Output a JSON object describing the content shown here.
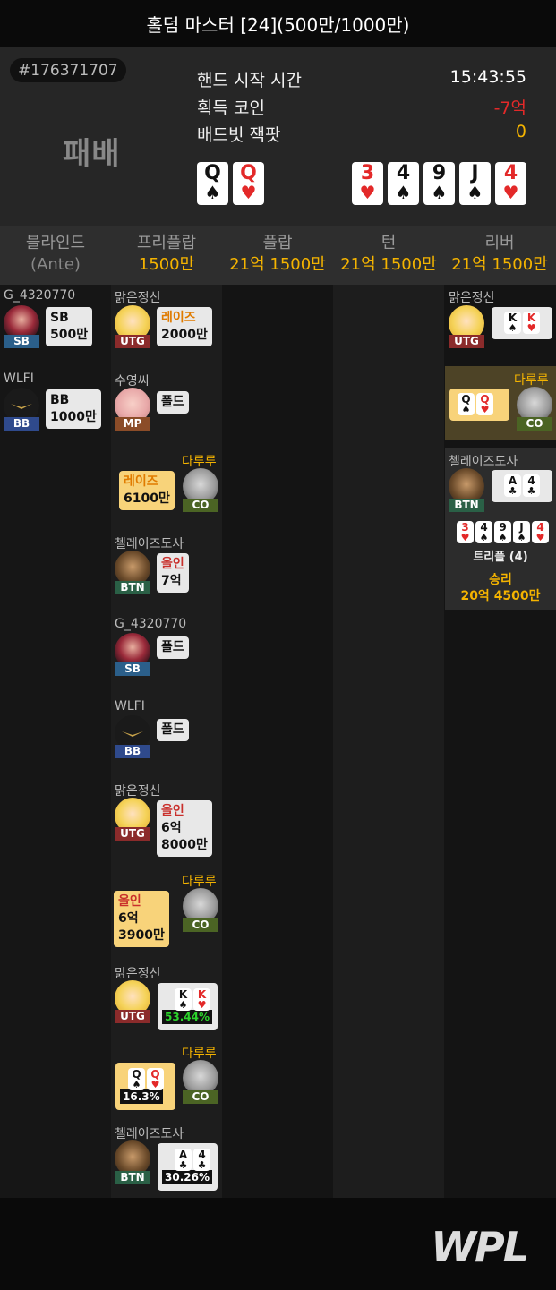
{
  "title": "홀덤 마스터 [24](500만/1000만)",
  "hand_id": "#176371707",
  "result": "패배",
  "info": [
    {
      "label": "핸드 시작 시간",
      "value": "15:43:55",
      "color": "#ffffff"
    },
    {
      "label": "획득 코인",
      "value": "-7억",
      "color": "#e32929"
    },
    {
      "label": "배드빗 잭팟",
      "value": "0",
      "color": "#f5b400"
    }
  ],
  "hole_cards": [
    {
      "rank": "Q",
      "suit": "♠"
    },
    {
      "rank": "Q",
      "suit": "♥"
    }
  ],
  "board_cards": [
    {
      "rank": "3",
      "suit": "♥"
    },
    {
      "rank": "4",
      "suit": "♠"
    },
    {
      "rank": "9",
      "suit": "♠"
    },
    {
      "rank": "J",
      "suit": "♠"
    },
    {
      "rank": "4",
      "suit": "♥"
    }
  ],
  "streets": [
    {
      "name": "블라인드",
      "amount": "(Ante)"
    },
    {
      "name": "프리플랍",
      "amount": "1500만"
    },
    {
      "name": "플랍",
      "amount": "21억 1500만"
    },
    {
      "name": "턴",
      "amount": "21억 1500만"
    },
    {
      "name": "리버",
      "amount": "21억 1500만"
    }
  ],
  "blinds": [
    {
      "name": "G_4320770",
      "position": "SB",
      "line1": "SB",
      "line2": "500만"
    },
    {
      "name": "WLFI",
      "position": "BB",
      "line1": "BB",
      "line2": "1000만"
    }
  ],
  "preflop": [
    {
      "name": "맑은정신",
      "position": "UTG",
      "action": "레이즈",
      "amount": "2000만"
    },
    {
      "name": "수영씨",
      "position": "MP",
      "action": "폴드"
    },
    {
      "name": "다루루",
      "position": "CO",
      "action": "레이즈",
      "amount": "6100만"
    },
    {
      "name": "첼레이즈도사",
      "position": "BTN",
      "action": "올인",
      "amount": "7억"
    },
    {
      "name": "G_4320770",
      "position": "SB",
      "action": "폴드"
    },
    {
      "name": "WLFI",
      "position": "BB",
      "action": "폴드"
    },
    {
      "name": "맑은정신",
      "position": "UTG",
      "action": "올인",
      "amount1": "6억",
      "amount2": "8000만"
    },
    {
      "name": "다루루",
      "position": "CO",
      "action": "올인",
      "amount1": "6억",
      "amount2": "3900만"
    },
    {
      "name": "맑은정신",
      "position": "UTG",
      "equity": "53.44%"
    },
    {
      "name": "다루루",
      "position": "CO",
      "equity": "16.3%"
    },
    {
      "name": "첼레이즈도사",
      "position": "BTN",
      "equity": "30.26%"
    }
  ],
  "river": {
    "players": [
      {
        "name": "맑은정신",
        "position": "UTG"
      },
      {
        "name": "다루루",
        "position": "CO"
      },
      {
        "name": "첼레이즈도사",
        "position": "BTN"
      }
    ],
    "hand_name": "트리플 (4)",
    "win_label": "승리",
    "win_amount": "20억 4500만"
  },
  "logo": "WPL",
  "colors": {
    "gold": "#f5b400",
    "loss": "#e32929",
    "card_red": "#e32929"
  }
}
